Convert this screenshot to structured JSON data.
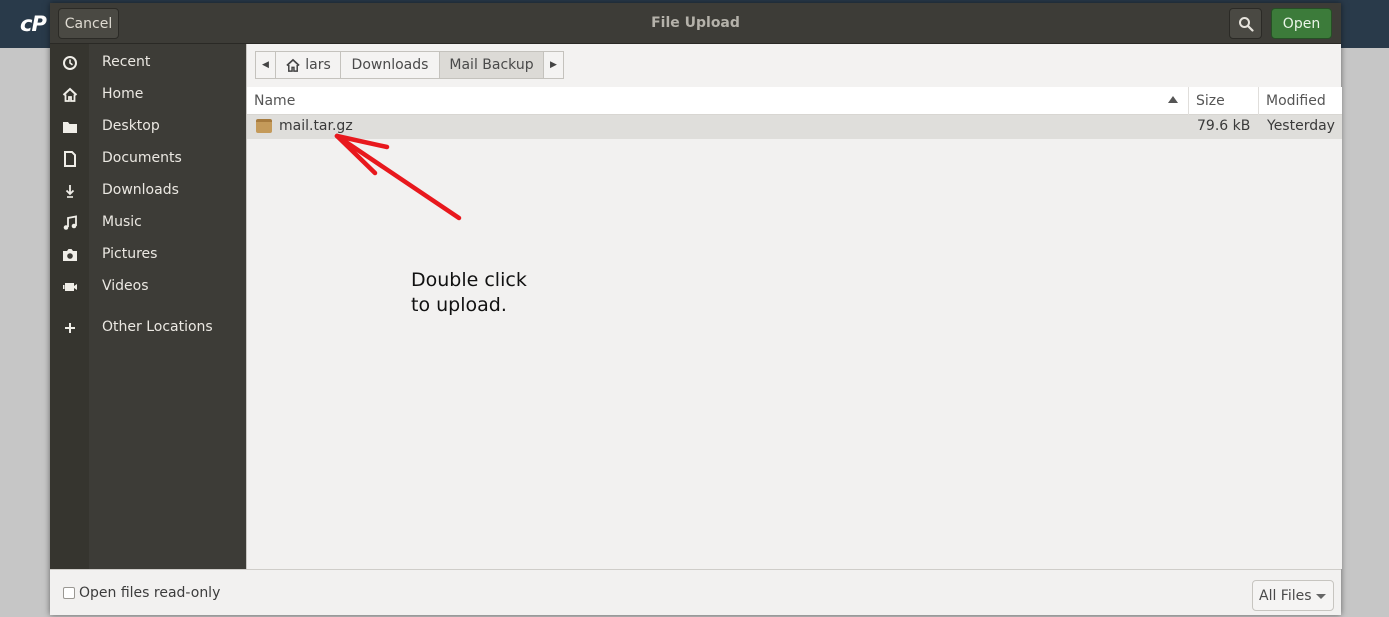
{
  "background": {
    "logo": "cP"
  },
  "dialog": {
    "title": "File Upload",
    "cancel_label": "Cancel",
    "open_label": "Open",
    "search_icon": "search-icon"
  },
  "sidebar": {
    "items": [
      {
        "label": "Recent",
        "icon": "clock-icon"
      },
      {
        "label": "Home",
        "icon": "home-icon"
      },
      {
        "label": "Desktop",
        "icon": "folder-icon"
      },
      {
        "label": "Documents",
        "icon": "document-icon"
      },
      {
        "label": "Downloads",
        "icon": "download-icon"
      },
      {
        "label": "Music",
        "icon": "music-icon"
      },
      {
        "label": "Pictures",
        "icon": "camera-icon"
      },
      {
        "label": "Videos",
        "icon": "video-icon"
      },
      {
        "label": "Other Locations",
        "icon": "plus-icon"
      }
    ]
  },
  "pathbar": {
    "crumbs": [
      "lars",
      "Downloads",
      "Mail Backup"
    ],
    "active_index": 2
  },
  "filelist": {
    "columns": {
      "name": "Name",
      "size": "Size",
      "modified": "Modified"
    },
    "sort": "name-ascending",
    "rows": [
      {
        "name": "mail.tar.gz",
        "size": "79.6 kB",
        "modified": "Yesterday",
        "icon": "archive-icon"
      }
    ]
  },
  "annotation": {
    "line1": "Double click",
    "line2": "to upload.",
    "arrow_color": "#e8181d"
  },
  "footer": {
    "readonly_label": "Open files read-only",
    "readonly_checked": false,
    "filter_value": "All Files"
  },
  "colors": {
    "headerbar": "#3d3c37",
    "open_button": "#3c7b3a",
    "sidebar": "#3d3c37",
    "selected_row": "#dfdedb"
  }
}
